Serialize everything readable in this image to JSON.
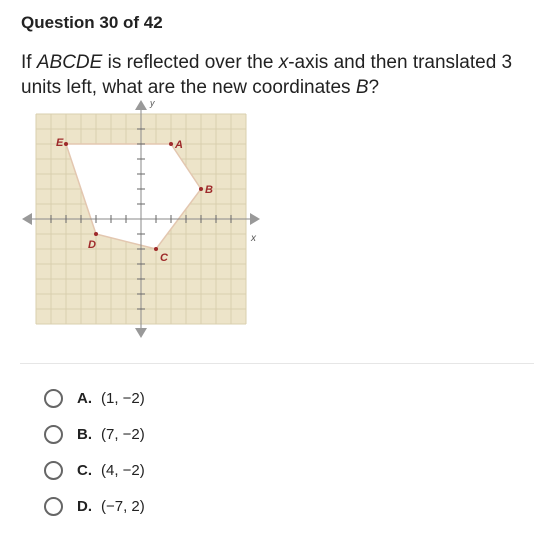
{
  "header": {
    "question_counter": "Question 30 of 42"
  },
  "question": {
    "parts": [
      {
        "text": "If ",
        "italic": false
      },
      {
        "text": "ABCDE",
        "italic": true
      },
      {
        "text": " is reflected over the ",
        "italic": false
      },
      {
        "text": "x",
        "italic": true
      },
      {
        "text": "-axis and then translated 3 units left, what are the new coordinates ",
        "italic": false
      },
      {
        "text": "B",
        "italic": true
      },
      {
        "text": "?",
        "italic": false
      }
    ]
  },
  "graph": {
    "x_axis_label": "x",
    "y_axis_label": "y",
    "range": [
      -7,
      7
    ],
    "points": [
      {
        "label": "A",
        "x": 2,
        "y": 5
      },
      {
        "label": "B",
        "x": 4,
        "y": 2
      },
      {
        "label": "C",
        "x": 1,
        "y": -2
      },
      {
        "label": "D",
        "x": -3,
        "y": -1
      },
      {
        "label": "E",
        "x": -5,
        "y": 5
      }
    ],
    "colors": {
      "background": "#ede4c9",
      "grid": "#d9cfae",
      "polygon_fill": "#ffffff",
      "polygon_stroke": "#e3c7b0",
      "point": "#9e2a2b",
      "axis": "#8a8a8a"
    }
  },
  "options": [
    {
      "letter": "A.",
      "value": "(1, −2)"
    },
    {
      "letter": "B.",
      "value": "(7, −2)"
    },
    {
      "letter": "C.",
      "value": "(4, −2)"
    },
    {
      "letter": "D.",
      "value": "(−7, 2)"
    }
  ]
}
